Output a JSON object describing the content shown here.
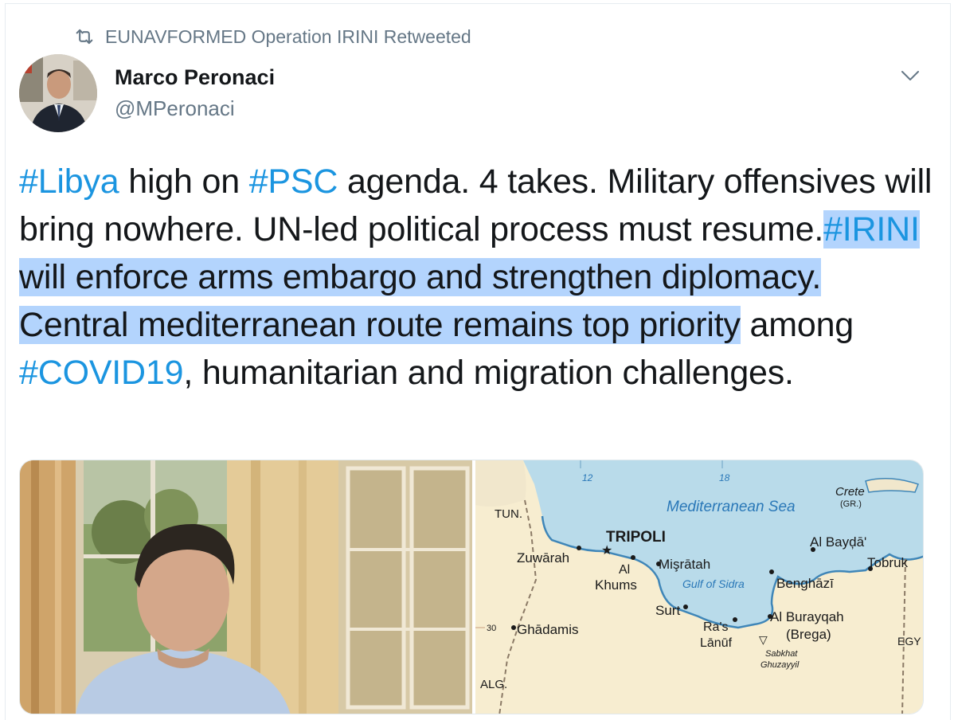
{
  "retweet": {
    "icon": "retweet-icon",
    "text": "EUNAVFORMED Operation IRINI Retweeted"
  },
  "author": {
    "name": "Marco Peronaci",
    "handle": "@MPeronaci"
  },
  "menu": {
    "icon": "chevron-down-icon"
  },
  "tweet": {
    "t1": "#Libya",
    "t2": " high on ",
    "t3": "#PSC",
    "t4": " agenda. 4 takes. Military offensives will bring nowhere. UN-led political process must resume.",
    "t5": "#IRINI",
    "t6": " will enforce arms embargo and strengthen diplomacy. Central mediterranean route remains top priority",
    "t7": " among ",
    "t8": "#COVID19",
    "t9": ", humanitarian and migration challenges."
  },
  "map": {
    "sea": "Mediterranean Sea",
    "crete": "Crete",
    "crete_gr": "(GR.)",
    "tun": "TUN.",
    "alg": "ALG.",
    "egy": "EGY",
    "tick12": "12",
    "tick18": "18",
    "tick30": "30",
    "tripoli": "TRIPOLI",
    "zuwarah": "Zuwārah",
    "al": "Al",
    "khums": "Khums",
    "misratah": "Mişrātah",
    "gulf": "Gulf of Sidra",
    "surt": "Surt",
    "ghadamis": "Ghādamis",
    "ras": "Ra's",
    "lanuf": "Lānūf",
    "albayda": "Al Bayḑā'",
    "tobruk": "Tobruk",
    "benghazi": "Benghāzī",
    "alburayqah": "Al Burayqah",
    "brega": "(Brega)",
    "sabkhat": "Sabkhat",
    "ghuzayyil": "Ghuzayyil"
  },
  "colors": {
    "hashtag": "#1b95e0",
    "selection": "#b3d4fd",
    "secondary": "#657786"
  }
}
